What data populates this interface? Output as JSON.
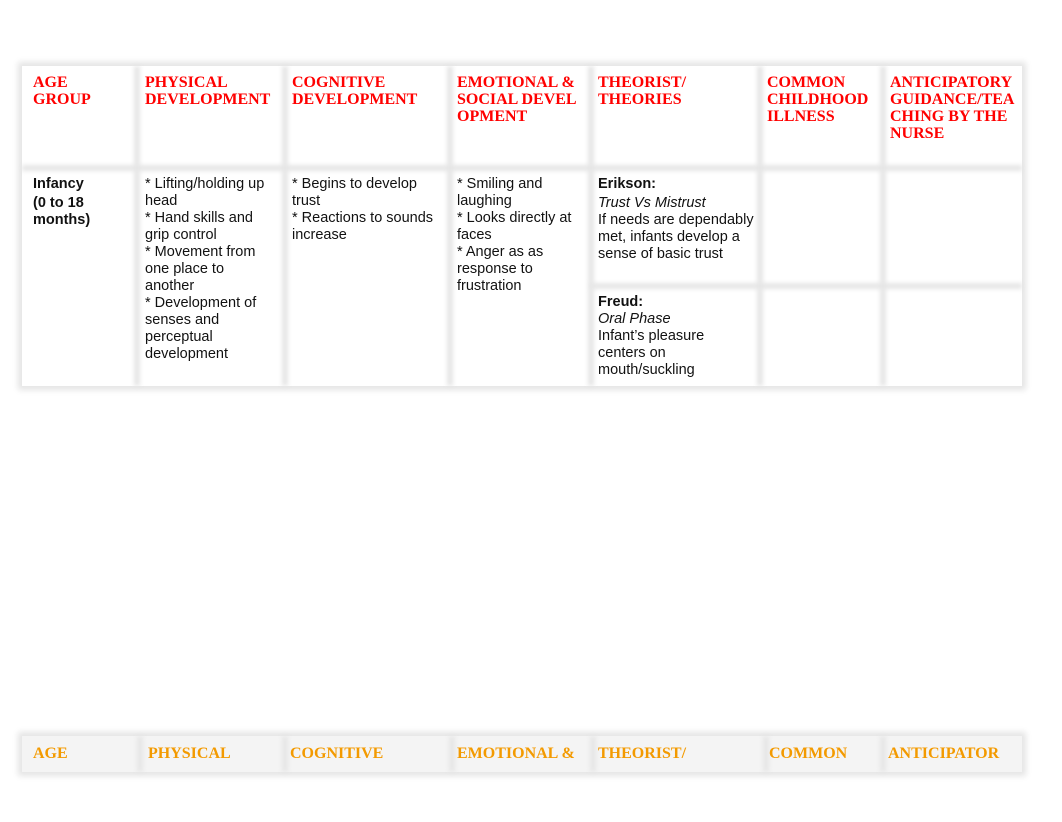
{
  "table1": {
    "headers": [
      "AGE GROUP",
      "PHYSICAL DEVELOPMENT",
      "COGNITIVE DEVELOPMENT",
      "EMOTIONAL & SOCIAL DEVELOPMENT",
      "THEORIST/ THEORIES",
      "COMMON CHILDHOOD ILLNESS",
      "ANTICIPATORY GUIDANCE/TEACHING BY THE NURSE"
    ],
    "row": {
      "age_group": "Infancy",
      "age_range": "(0 to 18 months)",
      "physical": [
        "* Lifting/holding up head",
        "* Hand skills and grip control",
        "* Movement from one place to another",
        "* Development of senses and perceptual development"
      ],
      "cognitive": [
        "* Begins to develop trust",
        "* Reactions to sounds increase"
      ],
      "emotional": [
        "* Smiling and laughing",
        "* Looks directly at faces",
        "* Anger as as response to frustration"
      ],
      "theorists": [
        {
          "name": "Erikson:",
          "theory": "Trust Vs Mistrust",
          "description": "If needs are dependably met, infants develop a sense of basic trust"
        },
        {
          "name": "Freud:",
          "theory": "Oral Phase",
          "description": "Infant’s pleasure centers on mouth/suckling"
        }
      ]
    }
  },
  "table2": {
    "headers": [
      "AGE",
      "PHYSICAL",
      "COGNITIVE",
      "EMOTIONAL &",
      "THEORIST/",
      "COMMON",
      "ANTICIPATOR"
    ]
  },
  "colors": {
    "header_red": "#ff0000",
    "header_orange": "#f39a00",
    "grid": "#e6e6e6"
  }
}
